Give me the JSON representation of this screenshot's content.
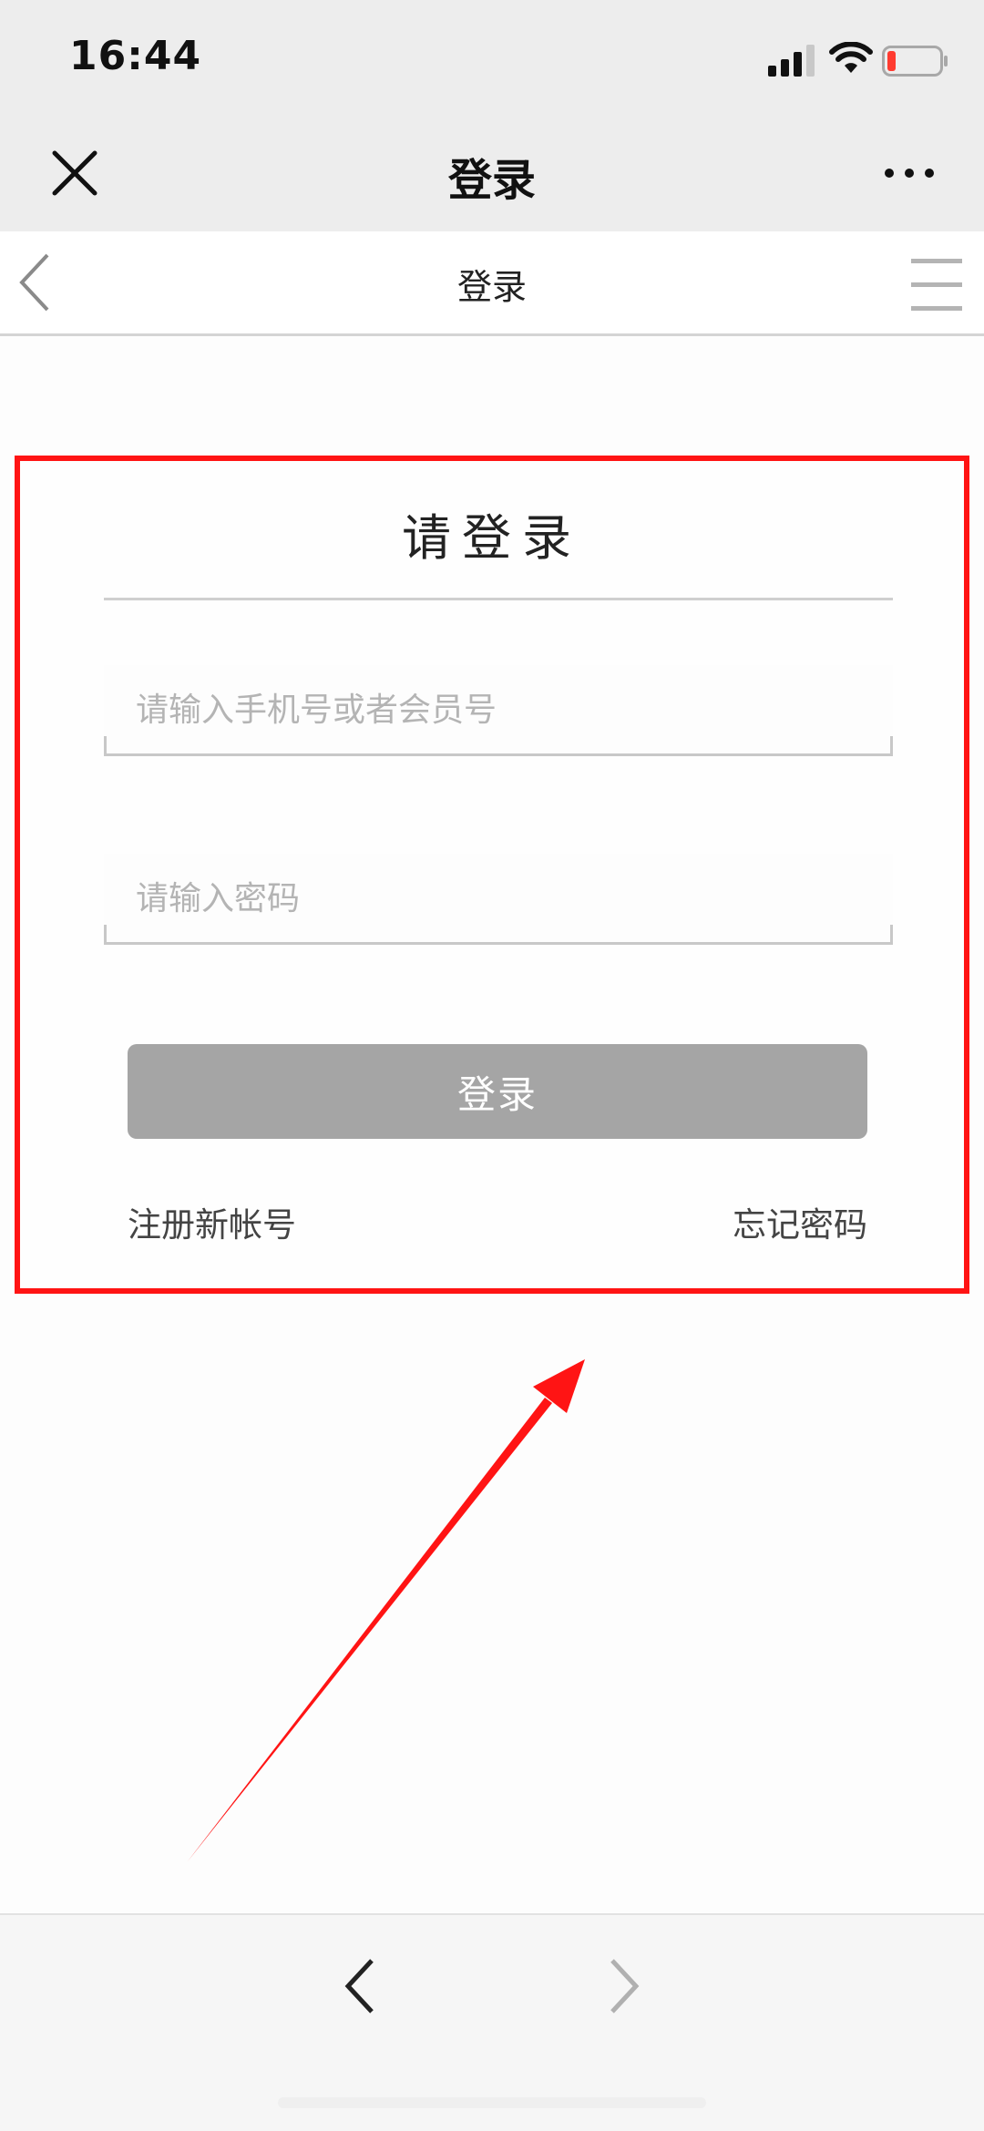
{
  "status_bar": {
    "time": "16:44",
    "icons": [
      "signal-icon",
      "wifi-icon",
      "battery-icon"
    ],
    "battery_level": 0.15,
    "battery_color": "#ff3b30"
  },
  "title_bar": {
    "title": "登录",
    "icons": [
      "close-icon",
      "more-icon"
    ]
  },
  "page_header": {
    "title": "登录",
    "icons": [
      "back-icon",
      "menu-icon"
    ]
  },
  "login_form": {
    "heading": "请登录",
    "phone_placeholder": "请输入手机号或者会员号",
    "phone_value": "",
    "password_placeholder": "请输入密码",
    "password_value": "",
    "submit_label": "登录",
    "register_label": "注册新帐号",
    "forgot_label": "忘记密码"
  },
  "bottom_nav": {
    "icons": [
      "nav-back-icon",
      "nav-forward-icon"
    ]
  },
  "colors": {
    "annotation": "#ff1414",
    "button": "#a5a5a5",
    "bar_background": "#ededed"
  }
}
